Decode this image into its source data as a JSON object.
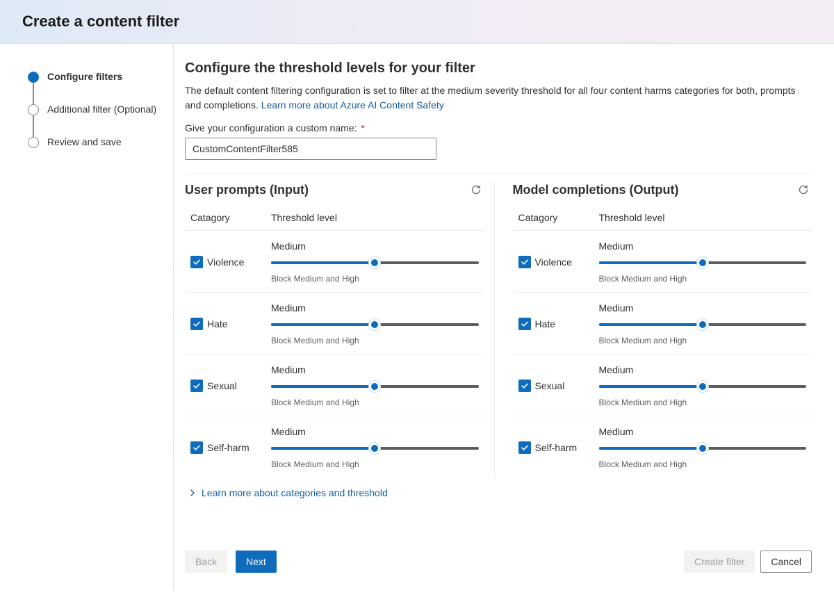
{
  "header": {
    "title": "Create a content filter"
  },
  "nav": {
    "steps": [
      {
        "label": "Configure filters",
        "active": true
      },
      {
        "label": "Additional filter (Optional)",
        "active": false
      },
      {
        "label": "Review and save",
        "active": false
      }
    ]
  },
  "main": {
    "title": "Configure the threshold levels for your filter",
    "description": "The default content filtering configuration is set to filter at the medium severity threshold for all four content harms categories for both, prompts and completions. ",
    "description_link": "Learn more about Azure AI Content Safety",
    "name_label": "Give your configuration a custom name:",
    "name_value": "CustomContentFilter585",
    "table": {
      "cat_header": "Catagory",
      "level_header": "Threshold level"
    },
    "columns": [
      {
        "title": "User prompts (Input)",
        "rows": [
          {
            "cat": "Violence",
            "level": "Medium",
            "desc": "Block Medium and High",
            "checked": true
          },
          {
            "cat": "Hate",
            "level": "Medium",
            "desc": "Block Medium and High",
            "checked": true
          },
          {
            "cat": "Sexual",
            "level": "Medium",
            "desc": "Block Medium and High",
            "checked": true
          },
          {
            "cat": "Self-harm",
            "level": "Medium",
            "desc": "Block Medium and High",
            "checked": true
          }
        ]
      },
      {
        "title": "Model completions (Output)",
        "rows": [
          {
            "cat": "Violence",
            "level": "Medium",
            "desc": "Block Medium and High",
            "checked": true
          },
          {
            "cat": "Hate",
            "level": "Medium",
            "desc": "Block Medium and High",
            "checked": true
          },
          {
            "cat": "Sexual",
            "level": "Medium",
            "desc": "Block Medium and High",
            "checked": true
          },
          {
            "cat": "Self-harm",
            "level": "Medium",
            "desc": "Block Medium and High",
            "checked": true
          }
        ]
      }
    ],
    "learn_more": "Learn more about categories and threshold"
  },
  "footer": {
    "back": "Back",
    "next": "Next",
    "create": "Create filter",
    "cancel": "Cancel"
  }
}
